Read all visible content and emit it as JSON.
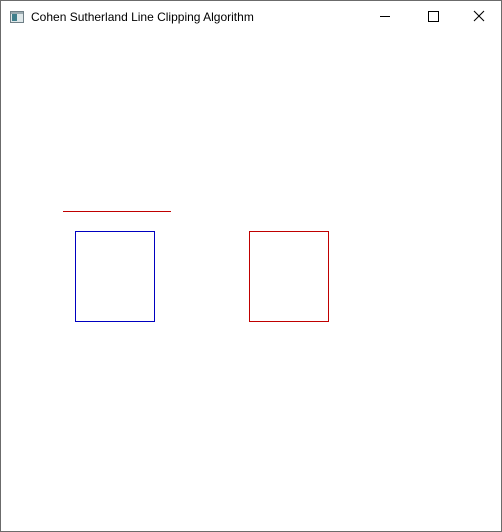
{
  "window": {
    "title": "Cohen Sutherland Line Clipping Algorithm",
    "icon": "app-window-icon",
    "controls": {
      "minimize_icon": "minimize-icon",
      "maximize_icon": "maximize-icon",
      "close_icon": "close-icon"
    }
  },
  "drawing": {
    "colors": {
      "line": "#c00000",
      "clip_window": "#0000c0",
      "clipped_window": "#c00000",
      "background": "#ffffff"
    },
    "items": [
      {
        "name": "original-line",
        "color": "#c00000"
      },
      {
        "name": "clipping-window-rectangle",
        "color": "#0000c0"
      },
      {
        "name": "result-rectangle",
        "color": "#c00000"
      }
    ]
  }
}
